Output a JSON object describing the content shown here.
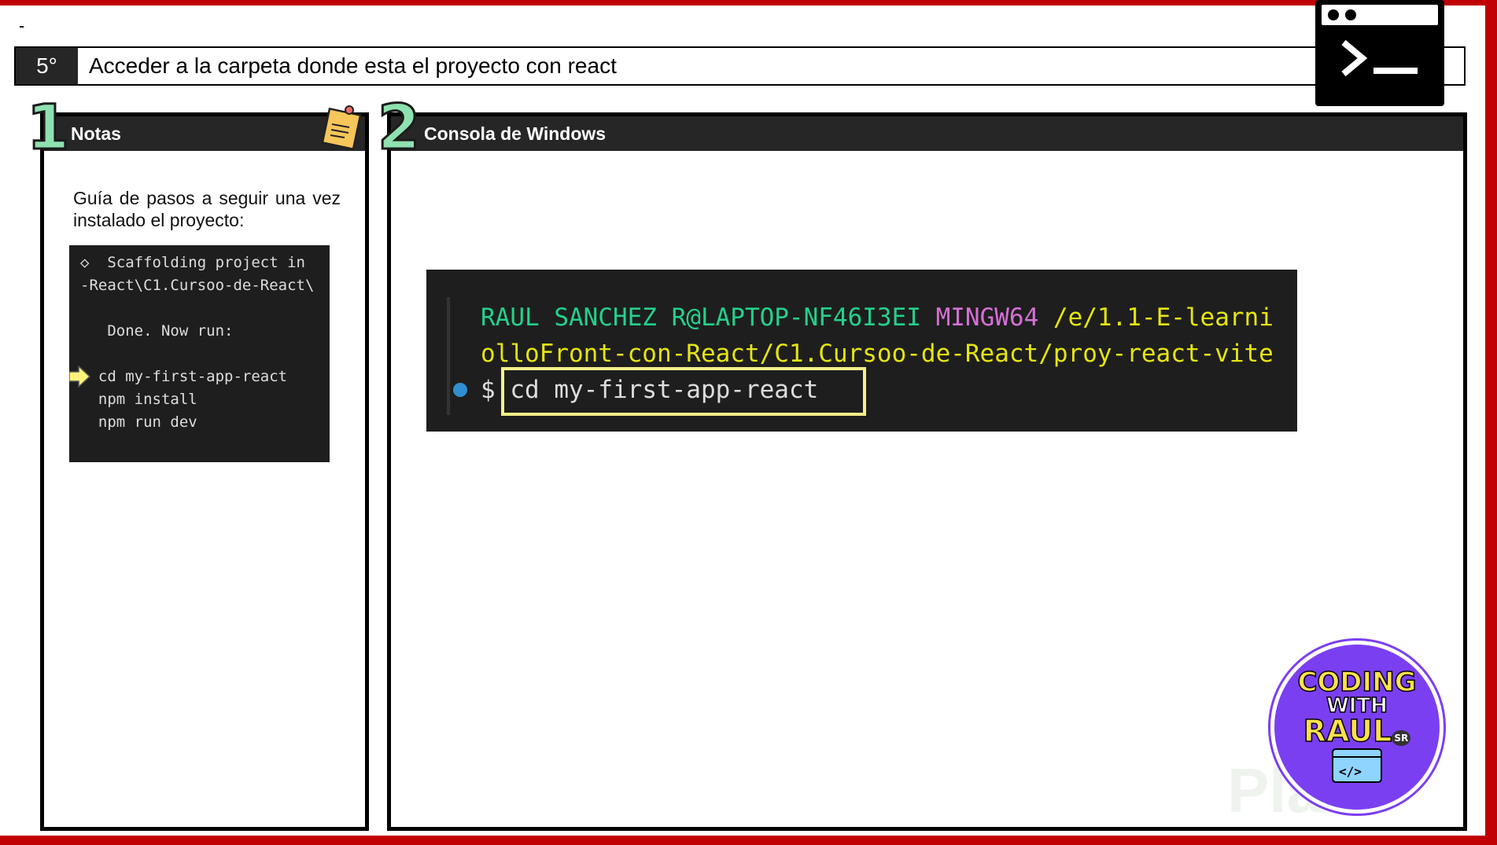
{
  "dash": "-",
  "header": {
    "step": "5°",
    "title": "Acceder a la carpeta donde esta el proyecto con react"
  },
  "notes": {
    "number": "1",
    "title": "Notas",
    "text": "Guía de pasos a seguir una vez instalado el proyecto:",
    "terminal_lines": [
      "◇  Scaffolding project in",
      "-React\\C1.Cursoo-de-React\\",
      "",
      "   Done. Now run:",
      "",
      "  cd my-first-app-react",
      "  npm install",
      "  npm run dev"
    ]
  },
  "console": {
    "number": "2",
    "title": "Consola de Windows",
    "user": "RAUL SANCHEZ R@LAPTOP-NF46I3EI",
    "env": "MINGW64",
    "path1": "/e/1.1-E-learni",
    "path2": "olloFront-con-React/C1.Cursoo-de-React/proy-react-vite",
    "prompt": "$",
    "command": "cd my-first-app-react"
  },
  "logo": {
    "line1": "CODING",
    "line2": "WITH",
    "line3": "RAUL",
    "badge": "SR"
  },
  "watermark": "Platzi"
}
